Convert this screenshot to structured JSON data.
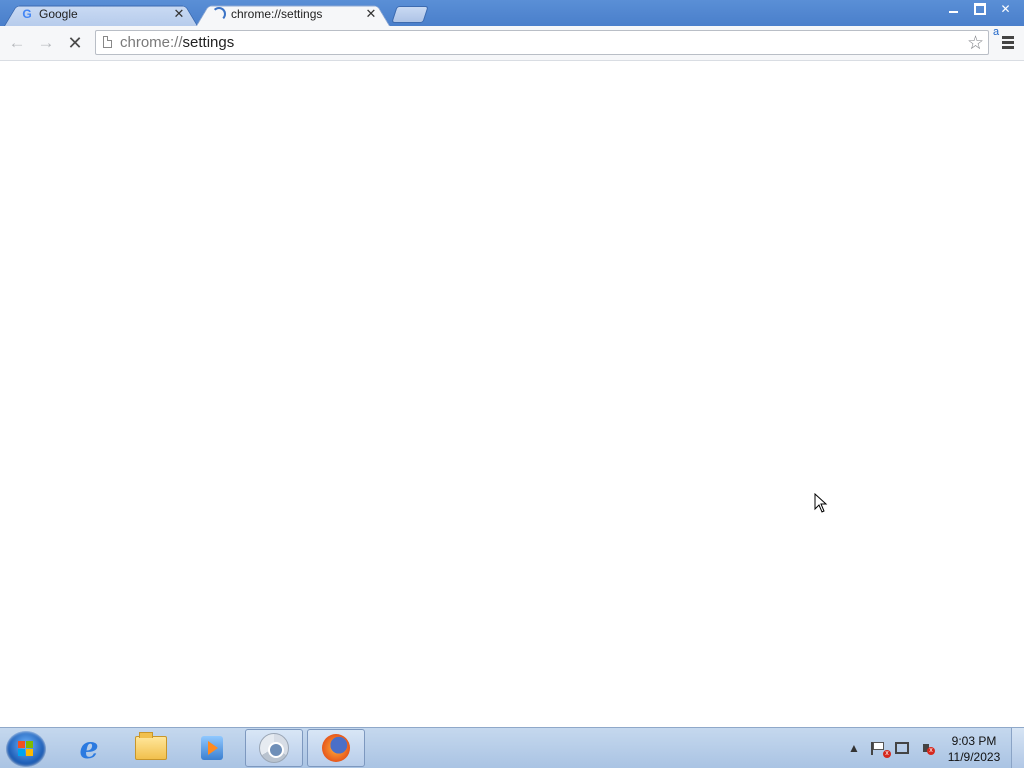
{
  "tabs": [
    {
      "title": "Google",
      "favicon": "G",
      "active": false
    },
    {
      "title": "chrome://settings",
      "favicon": "loading-spinner",
      "active": true
    }
  ],
  "toolbar": {
    "back": "←",
    "forward": "→",
    "stop": "✕",
    "url_scheme": "chrome://",
    "url_path": "settings",
    "star": "☆",
    "extension_letter": "a"
  },
  "window_controls": {
    "close": "✕"
  },
  "taskbar": {
    "apps": [
      "internet-explorer",
      "windows-explorer",
      "windows-media-player",
      "google-chrome",
      "mozilla-firefox"
    ],
    "clock_time": "9:03 PM",
    "clock_date": "11/9/2023",
    "tray_expand": "▲"
  },
  "colors": {
    "titlebar": "#4a7fcb",
    "toolbar": "#f6f7f9",
    "taskbar": "#b8cdea"
  }
}
